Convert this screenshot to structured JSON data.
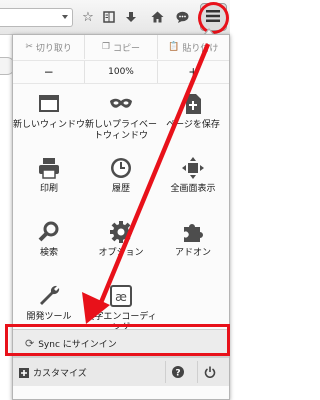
{
  "toolbar": {
    "icons": [
      "star-icon",
      "reading-list-icon",
      "download-icon",
      "home-icon",
      "chat-icon",
      "menu-icon"
    ]
  },
  "panel": {
    "edit": {
      "cut": "切り取り",
      "copy": "コピー",
      "paste": "貼り付け"
    },
    "zoom": {
      "minus": "−",
      "level": "100%",
      "plus": "+"
    },
    "items": [
      {
        "label": "新しいウィンドウ",
        "icon": "new-window-icon"
      },
      {
        "label": "新しいプライベートウィンドウ",
        "icon": "private-window-icon"
      },
      {
        "label": "ページを保存",
        "icon": "save-page-icon"
      },
      {
        "label": "印刷",
        "icon": "print-icon"
      },
      {
        "label": "履歴",
        "icon": "history-icon"
      },
      {
        "label": "全画面表示",
        "icon": "fullscreen-icon"
      },
      {
        "label": "検索",
        "icon": "search-icon"
      },
      {
        "label": "オプション",
        "icon": "options-icon"
      },
      {
        "label": "アドオン",
        "icon": "addons-icon"
      },
      {
        "label": "開発ツール",
        "icon": "developer-icon"
      },
      {
        "label": "文字エンコーディング",
        "icon": "encoding-icon"
      }
    ],
    "sync_label": "Sync にサインイン",
    "customize_label": "カスタマイズ"
  },
  "colors": {
    "highlight": "#e8111a"
  }
}
